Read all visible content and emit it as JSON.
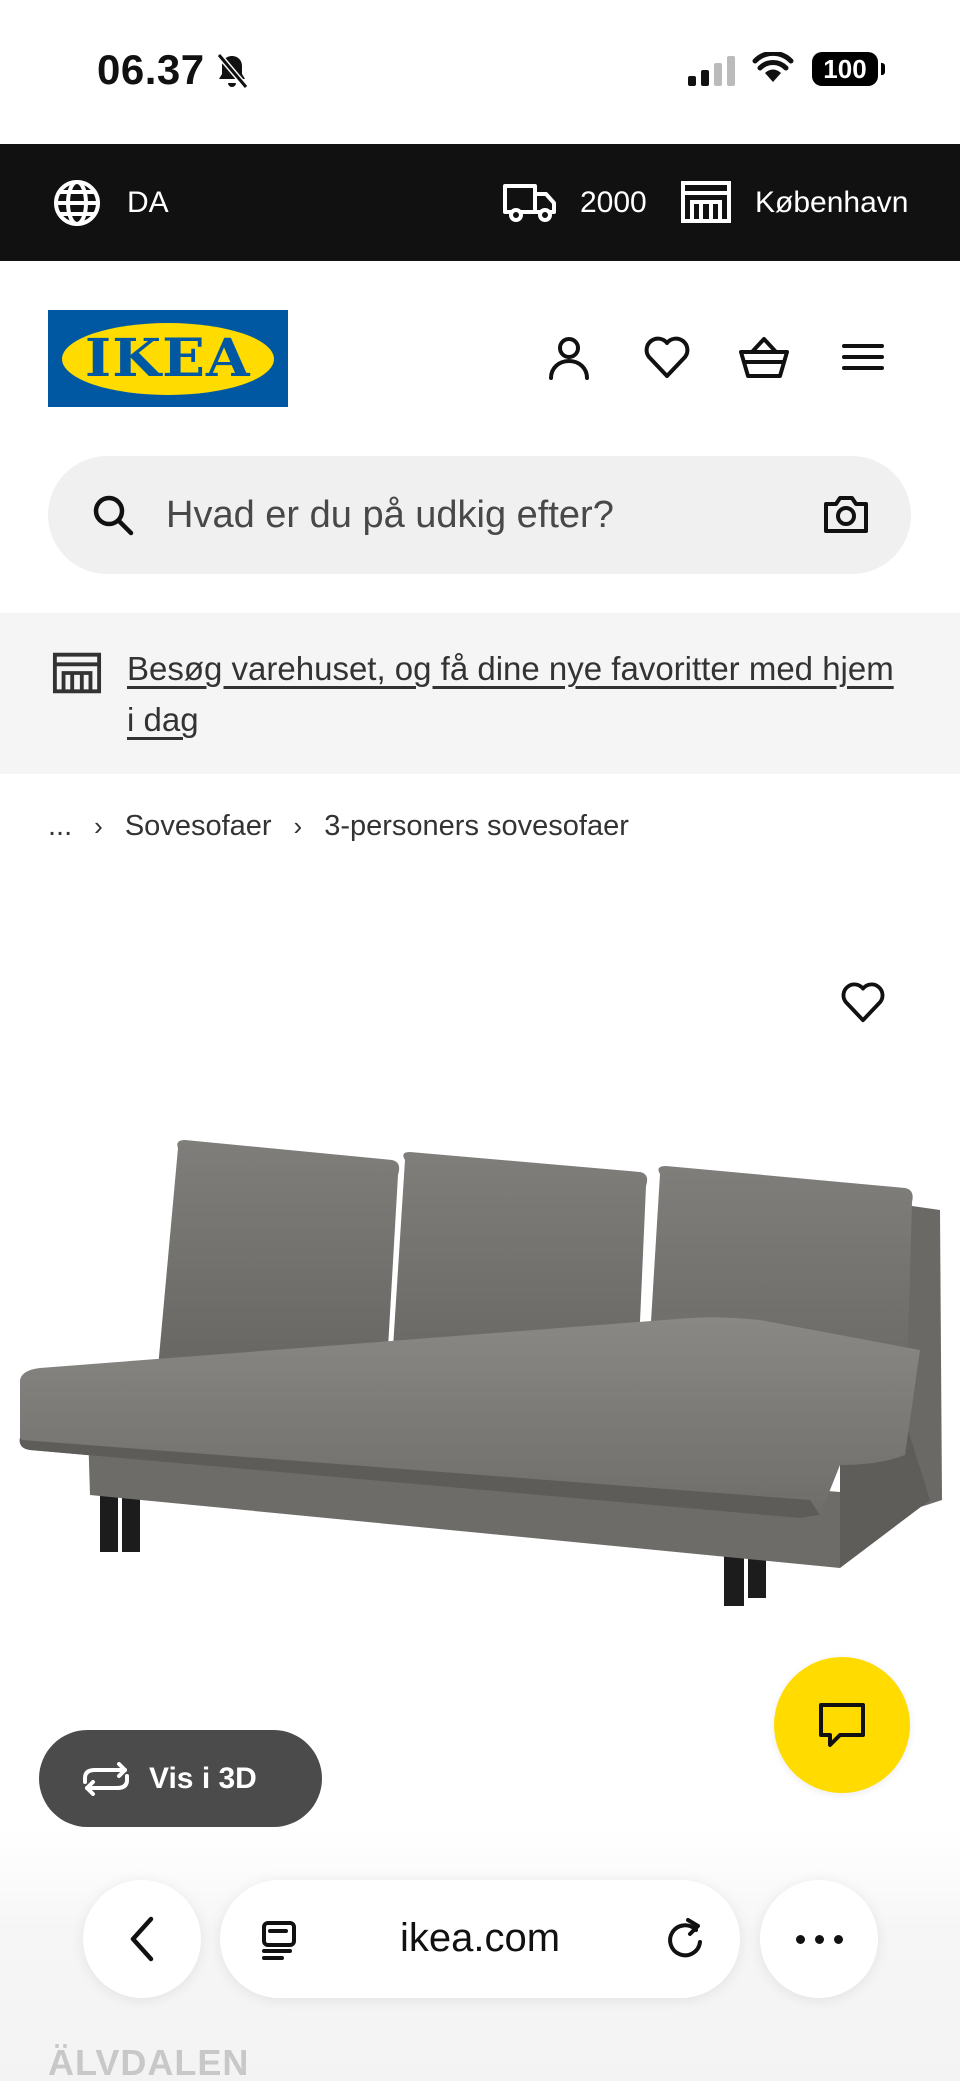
{
  "status_bar": {
    "time": "06.37",
    "battery": "100"
  },
  "top_bar": {
    "language": "DA",
    "postal_code": "2000",
    "store": "København"
  },
  "header": {
    "logo_text": "IKEA"
  },
  "search": {
    "placeholder": "Hvad er du på udkig efter?"
  },
  "promo": {
    "text": "Besøg varehuset, og få dine nye favoritter med hjem i dag"
  },
  "breadcrumb": [
    "...",
    "Sovesofaer",
    "3-personers sovesofaer"
  ],
  "product": {
    "view_3d_label": "Vis i 3D",
    "name": "ÄLVDALEN"
  },
  "browser": {
    "domain": "ikea.com"
  },
  "colors": {
    "ikea_blue": "#0058a3",
    "ikea_yellow": "#ffdb00",
    "top_bar": "#111111",
    "sofa_fabric": "#7d7b78"
  },
  "icons": [
    "bell-off-icon",
    "signal-icon",
    "wifi-icon",
    "globe-icon",
    "truck-icon",
    "store-icon",
    "user-icon",
    "heart-icon",
    "basket-icon",
    "menu-icon",
    "search-icon",
    "camera-icon",
    "rotate-3d-icon",
    "chat-icon",
    "back-icon",
    "tabs-icon",
    "reload-icon",
    "more-icon"
  ]
}
